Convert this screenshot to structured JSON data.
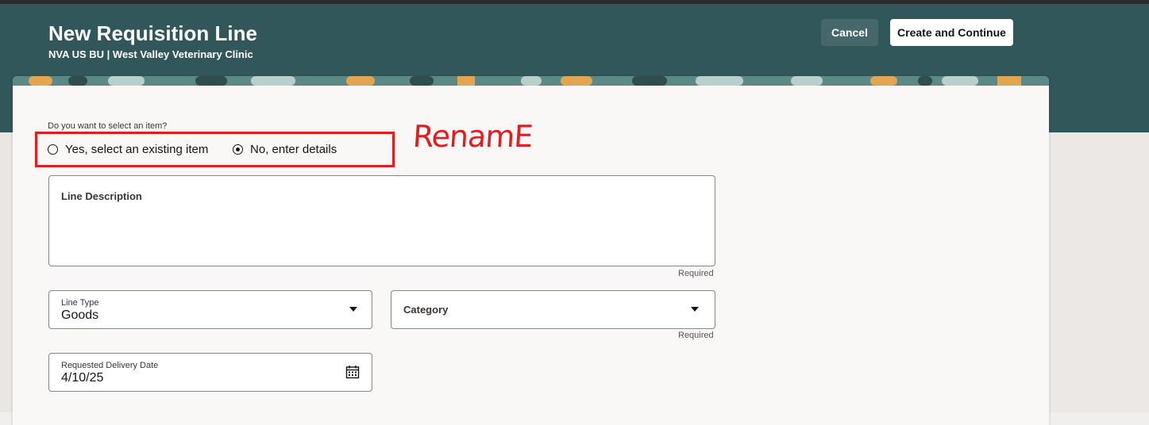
{
  "header": {
    "title": "New Requisition Line",
    "subtitle": "NVA US BU | West Valley Veterinary Clinic",
    "cancel_label": "Cancel",
    "create_label": "Create and Continue"
  },
  "form": {
    "item_question": "Do you want to select an item?",
    "radio_options": [
      {
        "label": "Yes, select an existing item",
        "selected": false
      },
      {
        "label": "No, enter details",
        "selected": true
      }
    ],
    "line_description": {
      "label": "Line Description",
      "value": "",
      "required_text": "Required"
    },
    "line_type": {
      "label": "Line Type",
      "value": "Goods"
    },
    "category": {
      "label": "Category",
      "value": "",
      "required_text": "Required"
    },
    "requested_delivery_date": {
      "label": "Requested Delivery Date",
      "value": "4/10/25"
    }
  },
  "annotation": {
    "text": "RenamE",
    "color": "#e01d21"
  },
  "colors": {
    "header_bg": "#31575b",
    "card_bg": "#f9f8f6",
    "annotation": "#e01d21"
  },
  "icons": {
    "dropdown": "caret-down-icon",
    "calendar": "calendar-icon"
  }
}
